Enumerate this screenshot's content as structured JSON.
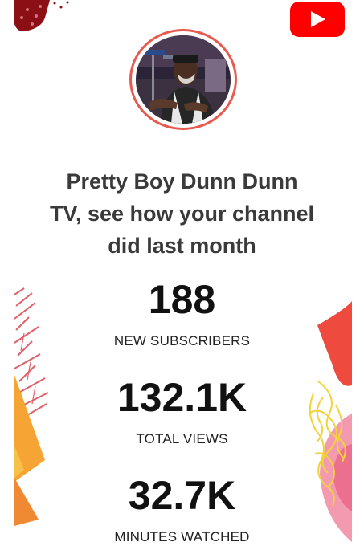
{
  "header": {
    "logo_icon": "youtube-play-icon",
    "brand_color": "#ff0000"
  },
  "channel": {
    "avatar_ring_color": "#e85a4f",
    "headline": "Pretty Boy Dunn Dunn TV, see how your channel did last month"
  },
  "stats": {
    "subscribers": {
      "value": "188",
      "label": "NEW SUBSCRIBERS"
    },
    "views": {
      "value": "132.1K",
      "label": "TOTAL VIEWS"
    },
    "minutes": {
      "value": "32.7K",
      "label": "MINUTES WATCHED"
    }
  }
}
